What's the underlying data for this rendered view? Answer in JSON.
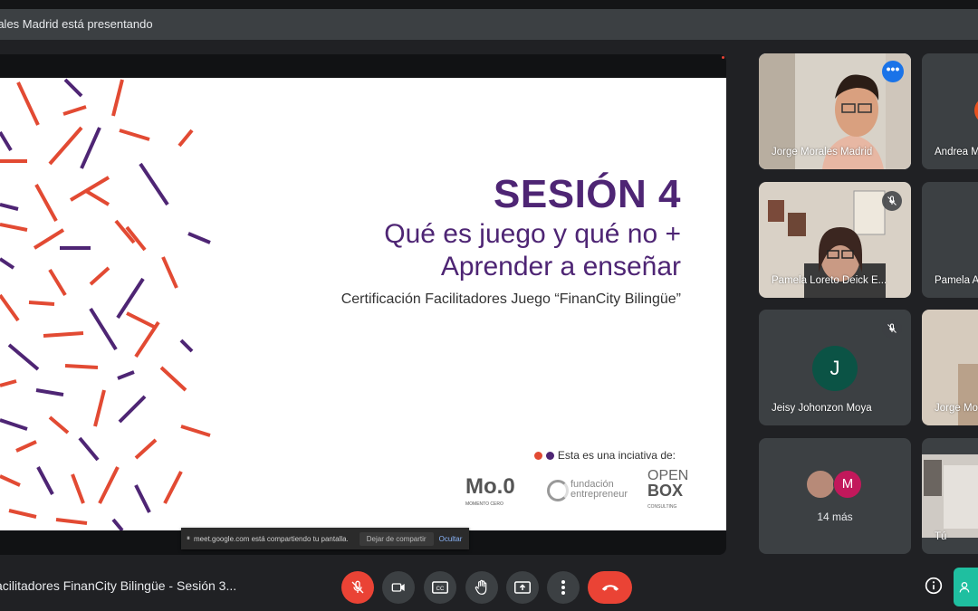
{
  "presenter_banner": "rales Madrid está presentando",
  "slide": {
    "title": "SESIÓN 4",
    "subtitle_line1": "Qué es juego y qué no +",
    "subtitle_line2": "Aprender a enseñar",
    "certification": "Certificación Facilitadores Juego “FinanCity Bilingüe”",
    "initiative_label": "Esta es una inciativa de:",
    "logo_momento": "Mo.0",
    "logo_momento_sub": "MOMENTO CERO",
    "logo_fundacion": "fundación",
    "logo_fundacion_sub": "entrepreneur",
    "logo_openbox_1": "OPEN",
    "logo_openbox_2": "BOX",
    "logo_openbox_sub": "CONSULTING",
    "colors": {
      "purple": "#4e2574",
      "red": "#e24a33"
    }
  },
  "share_notice": {
    "text": "meet.google.com está compartiendo tu pantalla.",
    "stop_label": "Dejar de compartir",
    "hide_label": "Ocultar"
  },
  "participants": {
    "jorge": "Jorge Morales Madrid",
    "andrea": "Andrea M",
    "pamela_l": "Pamela Loreto Deick E...",
    "pamela_a": "Pamela A",
    "jeisy": "Jeisy Johonzon Moya",
    "jeisy_initial": "J",
    "jorge_m": "Jorge Mo",
    "more_count": "14 más",
    "more_initial": "M",
    "you": "Tú"
  },
  "bottom": {
    "meeting_title": "acilitadores FinanCity Bilingüe - Sesión 3..."
  }
}
